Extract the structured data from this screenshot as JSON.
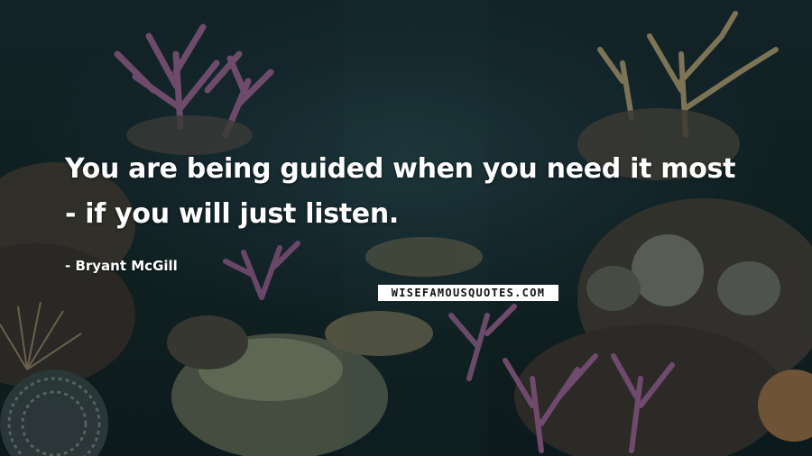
{
  "quote": {
    "line1": "You are being guided when you need it most",
    "line2": "-  if you will just listen."
  },
  "author": "- Bryant McGill",
  "watermark": "WISEFAMOUSQUOTES.COM",
  "colors": {
    "background": "#0f1d22",
    "text": "#ffffff",
    "coral_purple": "#6b4a6a",
    "coral_tan": "#8a7a5c"
  }
}
